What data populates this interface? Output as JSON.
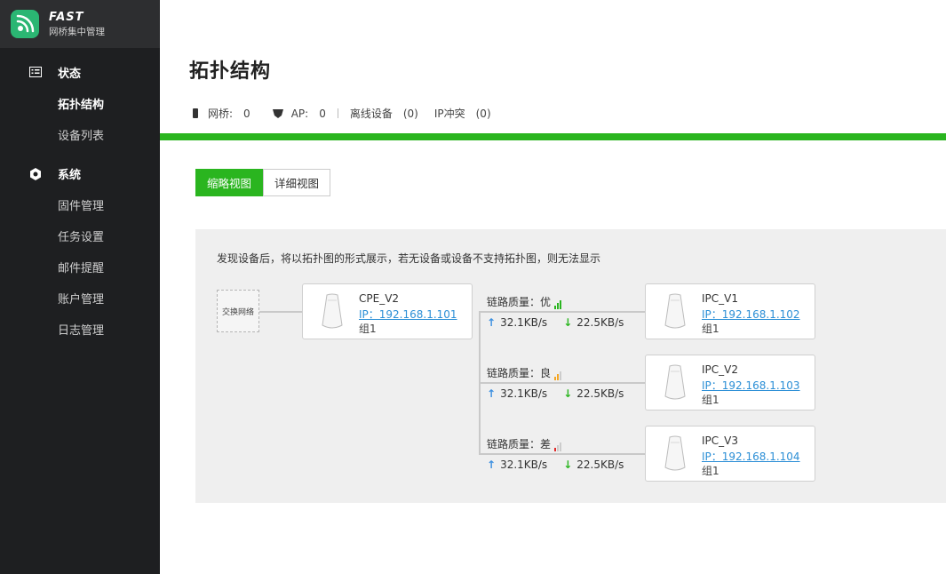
{
  "brand": {
    "name": "FAST",
    "subtitle": "网桥集中管理"
  },
  "sidebar": {
    "groups": [
      {
        "label": "状态",
        "icon": "list-icon",
        "items": [
          {
            "label": "拓扑结构",
            "active": true
          },
          {
            "label": "设备列表",
            "active": false
          }
        ]
      },
      {
        "label": "系统",
        "icon": "gear-icon",
        "items": [
          {
            "label": "固件管理"
          },
          {
            "label": "任务设置"
          },
          {
            "label": "邮件提醒"
          },
          {
            "label": "账户管理"
          },
          {
            "label": "日志管理"
          }
        ]
      }
    ]
  },
  "page": {
    "title": "拓扑结构",
    "stats": {
      "bridge_label": "网桥:",
      "bridge_count": "0",
      "ap_label": "AP:",
      "ap_count": "0",
      "offline_label": "离线设备",
      "offline_count": "(0)",
      "ipconflict_label": "IP冲突",
      "ipconflict_count": "(0)"
    }
  },
  "view_tabs": {
    "brief": "缩略视图",
    "detail": "详细视图",
    "active": "brief"
  },
  "topology": {
    "note": "发现设备后，将以拓扑图的形式展示，若无设备或设备不支持拓扑图，则无法显示",
    "switch_label": "交换网络",
    "root": {
      "name": "CPE_V2",
      "ip": "IP：192.168.1.101",
      "group": "组1"
    },
    "links": [
      {
        "quality_label": "链路质量：",
        "quality": "优",
        "up": "32.1KB/s",
        "down": "22.5KB/s",
        "bars": 3,
        "bar_color": "#2ab51f"
      },
      {
        "quality_label": "链路质量：",
        "quality": "良",
        "up": "32.1KB/s",
        "down": "22.5KB/s",
        "bars": 2,
        "bar_color": "#f5a623"
      },
      {
        "quality_label": "链路质量：",
        "quality": "差",
        "up": "32.1KB/s",
        "down": "22.5KB/s",
        "bars": 1,
        "bar_color": "#e02b2b"
      }
    ],
    "devices": [
      {
        "name": "IPC_V1",
        "ip": "IP：192.168.1.102",
        "group": "组1"
      },
      {
        "name": "IPC_V2",
        "ip": "IP：192.168.1.103",
        "group": "组1"
      },
      {
        "name": "IPC_V3",
        "ip": "IP：192.168.1.104",
        "group": "组1"
      }
    ]
  },
  "colors": {
    "accent": "#2ab51f",
    "sidebar_bg": "#1e1f21",
    "link": "#2c8fd6"
  }
}
